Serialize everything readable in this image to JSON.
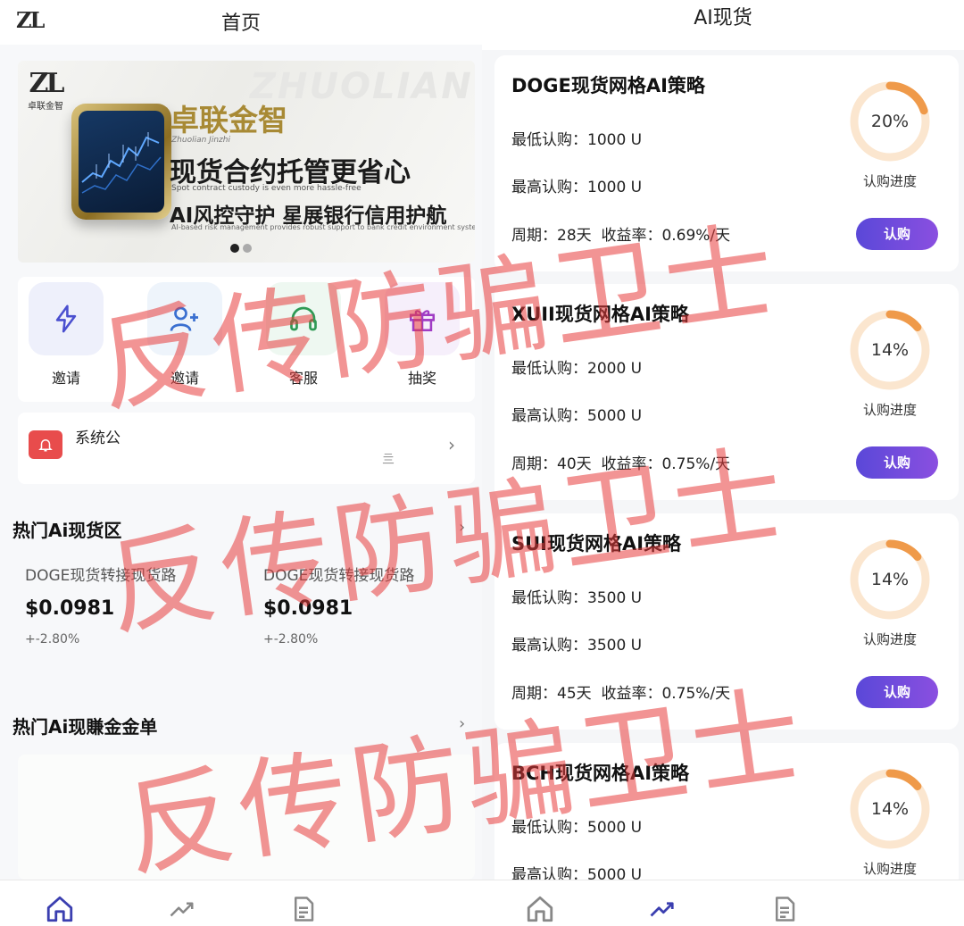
{
  "left_screen": {
    "logo": "ZL",
    "title": "首页",
    "banner": {
      "watermark": "ZHUOLIAN",
      "logo_text": "ZL",
      "logo_sub": "卓联金智",
      "brand": "卓联金智",
      "brand_en": "Zhuolian Jinzhi",
      "headline": "现货合约托管更省心",
      "headline_en": "Spot contract custody is even more hassle-free",
      "tagline": "AI风控守护 星展银行信用护航",
      "tagline_en": "AI-based risk management provides robust support to bank credit environment systems"
    },
    "quick_actions": [
      {
        "label": "邀请",
        "icon": "lightning-icon"
      },
      {
        "label": "邀请",
        "icon": "add-user-icon"
      },
      {
        "label": "客服",
        "icon": "headset-icon"
      },
      {
        "label": "抽奖",
        "icon": "gift-icon"
      }
    ],
    "notice": {
      "text": "系统公",
      "mark": "亖"
    },
    "hot_section": {
      "title": "热门Ai现货区"
    },
    "coins": [
      {
        "name": "DOGE现货转接现货路",
        "price": "$0.0981",
        "change": "+-2.80%"
      },
      {
        "name": "DOGE现货转接现货路",
        "price": "$0.0981",
        "change": "+-2.80%"
      }
    ],
    "leaderboard": {
      "title": "热门Ai现賺金金单"
    },
    "tabs": [
      {
        "icon": "home-icon",
        "active": true
      },
      {
        "icon": "trend-icon",
        "active": false
      },
      {
        "icon": "document-icon",
        "active": false
      }
    ]
  },
  "right_screen": {
    "title": "AI现货",
    "strategies": [
      {
        "name": "DOGE现货网格AI策略",
        "min": "最低认购：1000 U",
        "max": "最高认购：1000 U",
        "cycle": "周期：28天",
        "rate": "收益率：0.69%/天",
        "progress": "20%",
        "progress_value": 20,
        "progress_label": "认购进度",
        "button": "认购"
      },
      {
        "name": "XUII现货网格AI策略",
        "min": "最低认购：2000 U",
        "max": "最高认购：5000 U",
        "cycle": "周期：40天",
        "rate": "收益率：0.75%/天",
        "progress": "14%",
        "progress_value": 14,
        "progress_label": "认购进度",
        "button": "认购"
      },
      {
        "name": "SUI现货网格AI策略",
        "min": "最低认购：3500 U",
        "max": "最高认购：3500 U",
        "cycle": "周期：45天",
        "rate": "收益率：0.75%/天",
        "progress": "14%",
        "progress_value": 14,
        "progress_label": "认购进度",
        "button": "认购"
      },
      {
        "name": "BCH现货网格AI策略",
        "min": "最低认购：5000 U",
        "max": "最高认购：5000 U",
        "cycle": "",
        "rate": "",
        "progress": "14%",
        "progress_value": 14,
        "progress_label": "认购进度",
        "button": ""
      }
    ],
    "tabs": [
      {
        "icon": "home-icon",
        "active": false
      },
      {
        "icon": "trend-icon",
        "active": true
      },
      {
        "icon": "document-icon",
        "active": false
      }
    ]
  },
  "watermark": {
    "text": "反传防骗卫士",
    "color": "#e83c3c"
  },
  "colors": {
    "accent_purple": "#5a48d8",
    "ring_orange": "#ef9a4a",
    "ring_track": "#fbe6cf",
    "brand_gold": "#a88a35"
  }
}
